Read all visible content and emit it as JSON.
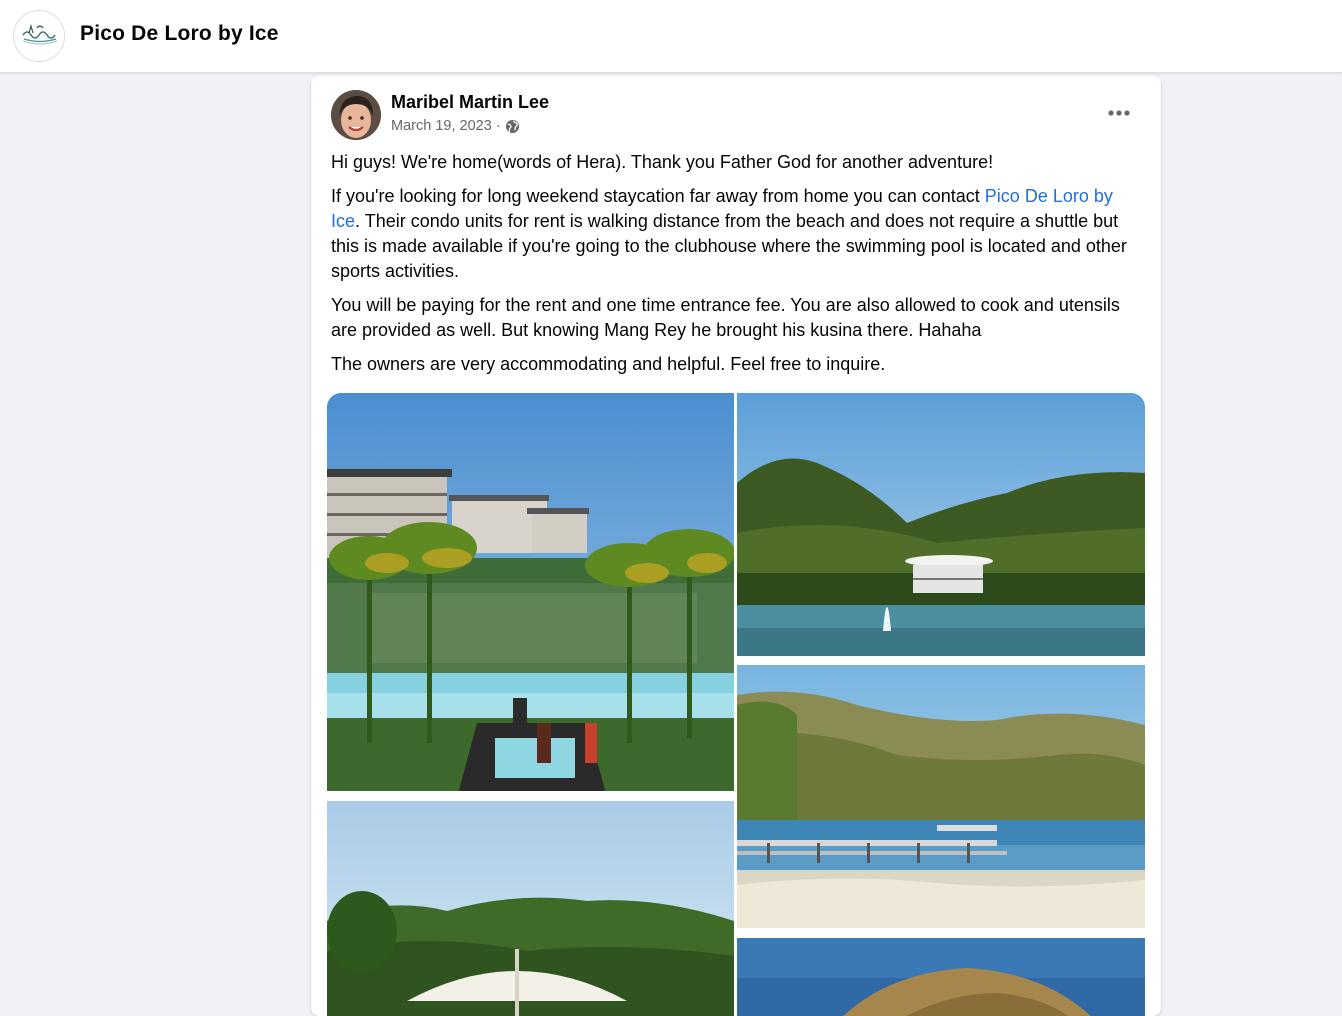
{
  "page": {
    "name": "Pico De Loro by Ice",
    "avatar_icon": "pico-de-loro-logo-icon"
  },
  "post": {
    "author": "Maribel Martin Lee",
    "date": "March 19, 2023",
    "separator": "·",
    "privacy_icon": "globe-icon",
    "more_icon": "more-options-icon",
    "paragraph1": "Hi guys! We're home(words of Hera). Thank you Father God for another adventure!",
    "paragraph2_before": "If you're looking for long weekend staycation far away from home you can contact ",
    "paragraph2_link": "Pico De Loro by Ice",
    "paragraph2_after": ". Their condo units for rent is walking distance from the beach and does not require a shuttle but this is made available if you're going to the clubhouse where the swimming pool is located and other sports activities.",
    "paragraph3": "You will be paying for the rent and one time entrance fee. You are also allowed to cook and utensils are provided as well. But knowing Mang Rey he brought his kusina there. Hahaha",
    "paragraph4": "The owners are very accommodating and helpful. Feel free to inquire.",
    "link_color": "#216fdb"
  }
}
